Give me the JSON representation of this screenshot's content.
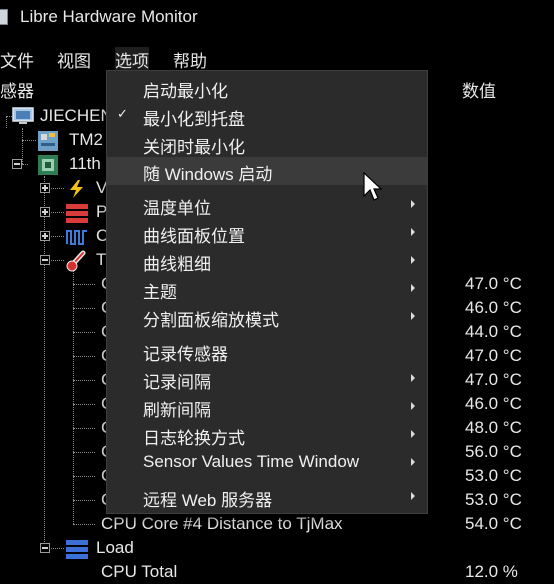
{
  "window": {
    "title": "Libre Hardware Monitor"
  },
  "menubar": [
    "文件",
    "视图",
    "选项",
    "帮助"
  ],
  "columns": {
    "sensor": "感器",
    "value": "数值"
  },
  "tree": [
    {
      "label": "JIECHEN",
      "value": "",
      "icon": "computer-icon"
    },
    {
      "label": "TM2",
      "value": "",
      "icon": "motherboard-icon"
    },
    {
      "label": "11th",
      "value": "",
      "icon": "cpu-icon"
    },
    {
      "label": "V",
      "value": "",
      "icon": "voltage-icon"
    },
    {
      "label": "P",
      "value": "",
      "icon": "power-icon"
    },
    {
      "label": "C",
      "value": "",
      "icon": "clock-icon"
    },
    {
      "label": "T",
      "value": "",
      "icon": "thermometer-icon"
    },
    {
      "label": "C",
      "value": "47.0 °C"
    },
    {
      "label": "C",
      "value": "46.0 °C"
    },
    {
      "label": "C",
      "value": "44.0 °C"
    },
    {
      "label": "C",
      "value": "47.0 °C"
    },
    {
      "label": "C",
      "value": "47.0 °C"
    },
    {
      "label": "C",
      "value": "46.0 °C"
    },
    {
      "label": "C",
      "value": "48.0 °C"
    },
    {
      "label": "C",
      "value": "56.0 °C"
    },
    {
      "label": "C",
      "value": "53.0 °C"
    },
    {
      "label": "C",
      "value": "53.0 °C"
    },
    {
      "label": "CPU Core #4 Distance to TjMax",
      "value": "54.0 °C"
    },
    {
      "label": "Load",
      "value": "",
      "icon": "load-icon"
    },
    {
      "label": "CPU Total",
      "value": "12.0 %"
    }
  ],
  "options_menu": [
    {
      "label": "启动最小化",
      "checked": false,
      "submenu": false
    },
    {
      "label": "最小化到托盘",
      "checked": true,
      "submenu": false
    },
    {
      "label": "关闭时最小化",
      "checked": false,
      "submenu": false
    },
    {
      "label": "随 Windows 启动",
      "checked": false,
      "submenu": false,
      "hover": true
    },
    {
      "label": "温度单位",
      "checked": false,
      "submenu": true
    },
    {
      "label": "曲线面板位置",
      "checked": false,
      "submenu": true
    },
    {
      "label": "曲线粗细",
      "checked": false,
      "submenu": true
    },
    {
      "label": "主题",
      "checked": false,
      "submenu": true
    },
    {
      "label": "分割面板缩放模式",
      "checked": false,
      "submenu": true
    },
    {
      "label": "记录传感器",
      "checked": false,
      "submenu": false
    },
    {
      "label": "记录间隔",
      "checked": false,
      "submenu": true
    },
    {
      "label": "刷新间隔",
      "checked": false,
      "submenu": true
    },
    {
      "label": "日志轮换方式",
      "checked": false,
      "submenu": true
    },
    {
      "label": "Sensor Values Time Window",
      "checked": false,
      "submenu": true
    },
    {
      "label": "远程 Web 服务器",
      "checked": false,
      "submenu": true
    }
  ],
  "colors": {
    "background": "#000000",
    "menu_bg": "#2b2b2b",
    "menu_hover": "#3b3b3b",
    "text": "#e8e8e8"
  }
}
